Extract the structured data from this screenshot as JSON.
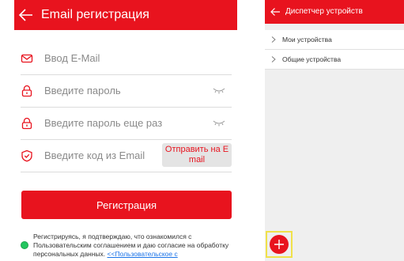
{
  "left": {
    "title": "Email регистрация",
    "fields": {
      "email_placeholder": "Ввод E-Mail",
      "password_placeholder": "Введите пароль",
      "password_repeat_placeholder": "Введите пароль еще раз",
      "code_placeholder": "Введите код из Email"
    },
    "send_code_label": "Отправить на E mail",
    "register_label": "Регистрация",
    "agreement": {
      "text": "Регистрируясь, я подтверждаю, что ознакомился с Пользовательским соглашением и даю согласие на обработку персональных данных. ",
      "link": "<<Пользовательское с"
    }
  },
  "right": {
    "title": "Диспетчер устройств",
    "items": [
      {
        "label": "Мои устройства"
      },
      {
        "label": "Общие устройства"
      }
    ]
  },
  "colors": {
    "accent": "#e8131e",
    "agree_radio": "#22c55e",
    "highlight": "#f0e14a"
  }
}
